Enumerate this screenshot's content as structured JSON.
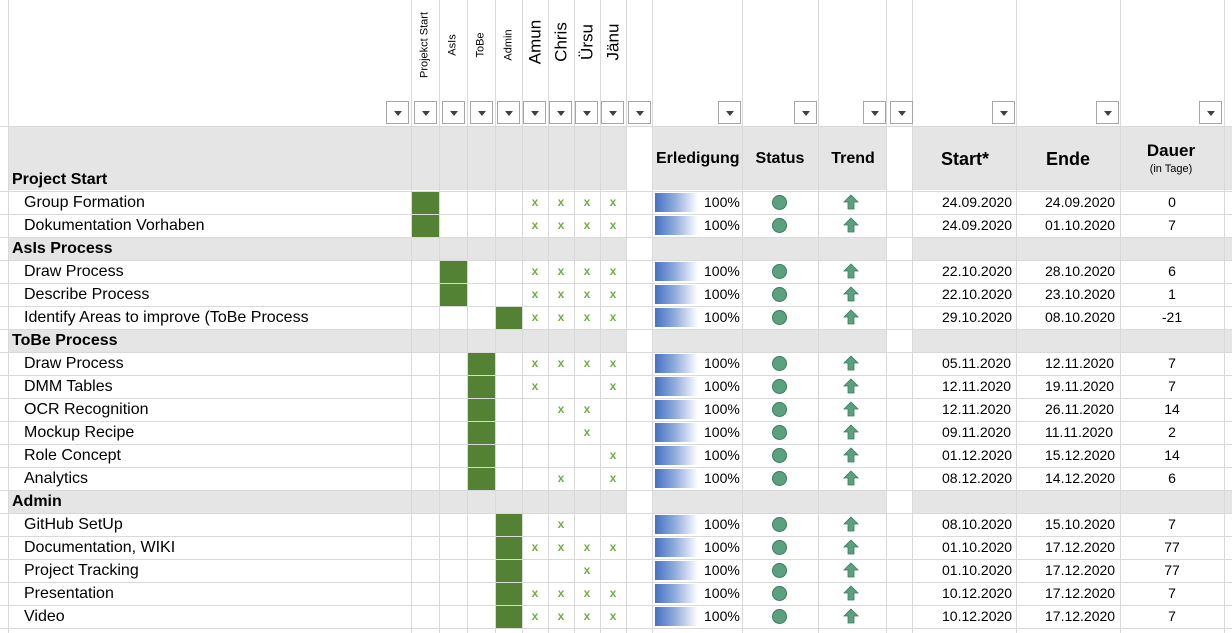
{
  "header": {
    "rotated_small": [
      "Projekct Start",
      "AsIs",
      "ToBe",
      "Admin"
    ],
    "rotated_large": [
      "Amun",
      "Chris",
      "Ürsu",
      "Jänu"
    ],
    "erledigung": "Erledigung",
    "status": "Status",
    "trend": "Trend",
    "start": "Start*",
    "ende": "Ende",
    "dauer": "Dauer",
    "dauer_sub": "(in Tage)"
  },
  "colors": {
    "phase_block": "#548235",
    "check": "#70ad47",
    "status_dot": "#5aa17f",
    "trend_arrow": "#5aa17f",
    "section_band": "#e5e5e5"
  },
  "icons": {
    "status": "green-circle-icon",
    "trend": "up-arrow-icon",
    "filter": "dropdown-filter-icon"
  },
  "rows": [
    {
      "kind": "section",
      "label": "Project Start"
    },
    {
      "kind": "task",
      "label": "Group Formation",
      "phase": 0,
      "checks": [
        1,
        1,
        1,
        1
      ],
      "pct": "100%",
      "start": "24.09.2020",
      "end": "24.09.2020",
      "dur": "0"
    },
    {
      "kind": "task",
      "label": "Dokumentation Vorhaben",
      "phase": 0,
      "checks": [
        1,
        1,
        1,
        1
      ],
      "pct": "100%",
      "start": "24.09.2020",
      "end": "01.10.2020",
      "dur": "7"
    },
    {
      "kind": "section",
      "label": "AsIs Process"
    },
    {
      "kind": "task",
      "label": "Draw Process",
      "phase": 1,
      "checks": [
        1,
        1,
        1,
        1
      ],
      "pct": "100%",
      "start": "22.10.2020",
      "end": "28.10.2020",
      "dur": "6"
    },
    {
      "kind": "task",
      "label": "Describe Process",
      "phase": 1,
      "checks": [
        1,
        1,
        1,
        1
      ],
      "pct": "100%",
      "start": "22.10.2020",
      "end": "23.10.2020",
      "dur": "1"
    },
    {
      "kind": "task",
      "label": "Identify Areas to improve (ToBe Process",
      "phase": 3,
      "checks": [
        1,
        1,
        1,
        1
      ],
      "pct": "100%",
      "start": "29.10.2020",
      "end": "08.10.2020",
      "dur": "-21"
    },
    {
      "kind": "section",
      "label": "ToBe Process"
    },
    {
      "kind": "task",
      "label": "Draw Process",
      "phase": 2,
      "checks": [
        1,
        1,
        1,
        1
      ],
      "pct": "100%",
      "start": "05.11.2020",
      "end": "12.11.2020",
      "dur": "7"
    },
    {
      "kind": "task",
      "label": "DMM Tables",
      "phase": 2,
      "checks": [
        1,
        0,
        0,
        1
      ],
      "pct": "100%",
      "start": "12.11.2020",
      "end": "19.11.2020",
      "dur": "7"
    },
    {
      "kind": "task",
      "label": "OCR Recognition",
      "phase": 2,
      "checks": [
        0,
        1,
        1,
        0
      ],
      "pct": "100%",
      "start": "12.11.2020",
      "end": "26.11.2020",
      "dur": "14"
    },
    {
      "kind": "task",
      "label": "Mockup Recipe",
      "phase": 2,
      "checks": [
        0,
        0,
        1,
        0
      ],
      "pct": "100%",
      "start": "09.11.2020",
      "end": "11.11.2020",
      "dur": "2"
    },
    {
      "kind": "task",
      "label": "Role Concept",
      "phase": 2,
      "checks": [
        0,
        0,
        0,
        1
      ],
      "pct": "100%",
      "start": "01.12.2020",
      "end": "15.12.2020",
      "dur": "14"
    },
    {
      "kind": "task",
      "label": "Analytics",
      "phase": 2,
      "checks": [
        0,
        1,
        0,
        1
      ],
      "pct": "100%",
      "start": "08.12.2020",
      "end": "14.12.2020",
      "dur": "6"
    },
    {
      "kind": "section",
      "label": "Admin"
    },
    {
      "kind": "task",
      "label": "GitHub SetUp",
      "phase": 3,
      "checks": [
        0,
        1,
        0,
        0
      ],
      "pct": "100%",
      "start": "08.10.2020",
      "end": "15.10.2020",
      "dur": "7"
    },
    {
      "kind": "task",
      "label": "Documentation, WIKI",
      "phase": 3,
      "checks": [
        1,
        1,
        1,
        1
      ],
      "pct": "100%",
      "start": "01.10.2020",
      "end": "17.12.2020",
      "dur": "77"
    },
    {
      "kind": "task",
      "label": "Project Tracking",
      "phase": 3,
      "checks": [
        0,
        0,
        1,
        0
      ],
      "pct": "100%",
      "start": "01.10.2020",
      "end": "17.12.2020",
      "dur": "77"
    },
    {
      "kind": "task",
      "label": "Presentation",
      "phase": 3,
      "checks": [
        1,
        1,
        1,
        1
      ],
      "pct": "100%",
      "start": "10.12.2020",
      "end": "17.12.2020",
      "dur": "7"
    },
    {
      "kind": "task",
      "label": "Video",
      "phase": 3,
      "checks": [
        1,
        1,
        1,
        1
      ],
      "pct": "100%",
      "start": "10.12.2020",
      "end": "17.12.2020",
      "dur": "7"
    }
  ]
}
